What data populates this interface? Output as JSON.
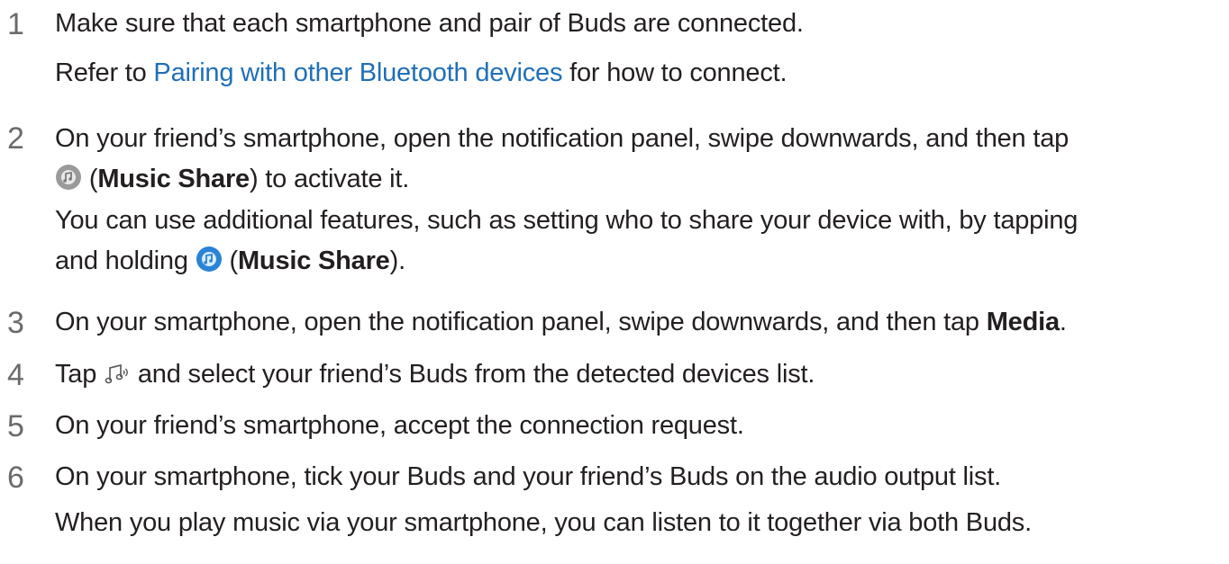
{
  "steps": [
    {
      "number": "1",
      "text_a": "Make sure that each smartphone and pair of Buds are connected.",
      "sub_prefix": "Refer to ",
      "sub_link": "Pairing with other Bluetooth devices",
      "sub_suffix": " for how to connect."
    },
    {
      "number": "2",
      "text_a": "On your friend’s smartphone, open the notification panel, swipe downwards, and then tap",
      "open_paren": " (",
      "bold_a": "Music Share",
      "suffix_a": ") to activate it.",
      "text_b": "You can use additional features, such as setting who to share your device with, by tapping",
      "prefix_c": "and holding ",
      "bold_c": "Music Share",
      "suffix_c": ")."
    },
    {
      "number": "3",
      "text_a": "On your smartphone, open the notification panel, swipe downwards, and then tap ",
      "bold_a": "Media",
      "suffix_a": "."
    },
    {
      "number": "4",
      "prefix": "Tap ",
      "suffix": " and select your friend’s Buds from the detected devices list."
    },
    {
      "number": "5",
      "text_a": "On your friend’s smartphone, accept the connection request."
    },
    {
      "number": "6",
      "text_a": "On your smartphone, tick your Buds and your friend’s Buds on the audio output list.",
      "text_b": "When you play music via your smartphone, you can listen to it together via both Buds."
    }
  ],
  "icons": {
    "music_share_off": "music-share-off-icon",
    "music_share_on": "music-share-on-icon",
    "audio_output": "audio-output-icon"
  },
  "colors": {
    "link": "#1f6fb8",
    "step_number": "#6b6b6b",
    "music_share_on": "#2a83d6",
    "music_share_off": "#9a9a9a"
  }
}
